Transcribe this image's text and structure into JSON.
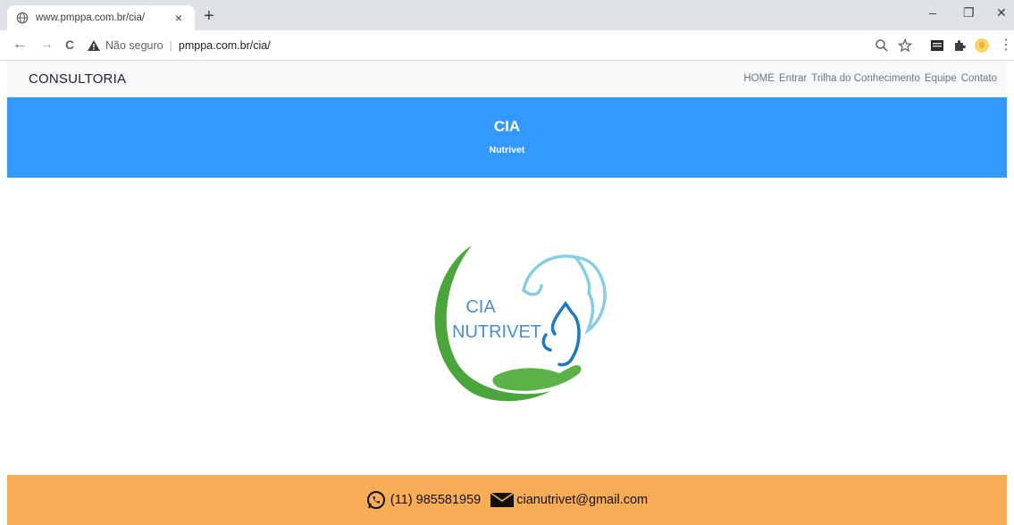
{
  "browser": {
    "tab_title": "www.pmppa.com.br/cia/",
    "tab_close": "×",
    "new_tab": "+",
    "security_label": "Não seguro",
    "separator": "|",
    "url": "pmppa.com.br/cia/",
    "window_controls": {
      "minimize": "–",
      "restore": "❐",
      "close": "✕"
    },
    "nav": {
      "back": "←",
      "forward": "→",
      "reload": "C"
    },
    "menu": "⋮"
  },
  "navbar": {
    "brand": "CONSULTORIA",
    "links": [
      "HOME",
      "Entrar",
      "Trilha do Conhecimento",
      "Equipe",
      "Contato"
    ]
  },
  "hero": {
    "title": "CIA",
    "subtitle": "Nutrivet"
  },
  "logo": {
    "line1": "CIA",
    "line2": "NUTRIVET"
  },
  "footer": {
    "phone": "(11) 985581959",
    "email": "cianutrivet@gmail.com"
  },
  "colors": {
    "hero_bg": "#3399ff",
    "footer_bg": "#f9ad57",
    "navbar_bg": "#f8f9fa",
    "logo_text": "#4a8fcc",
    "logo_green": "#4aa63a",
    "logo_lightblue": "#7ec8e3"
  },
  "icons": [
    "globe-icon",
    "warning-icon",
    "zoom-icon",
    "star-icon",
    "extension-icon",
    "puzzle-icon",
    "profile-icon",
    "whatsapp-icon",
    "mail-icon"
  ]
}
